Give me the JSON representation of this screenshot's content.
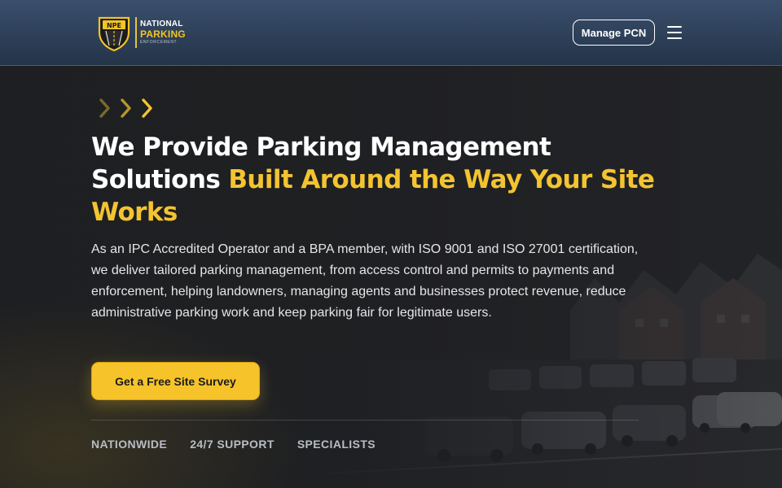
{
  "header": {
    "logo": {
      "badge_text": "NPE",
      "line1": "NATIONAL",
      "line2": "PARKING",
      "line3": "ENFORCEMENT"
    },
    "manage_pcn_label": "Manage PCN",
    "menu_icon": "hamburger-menu-icon"
  },
  "hero": {
    "decoration_icon": "triple-chevron-right-icon",
    "headline_part1": "We Provide Parking Management Solutions ",
    "headline_accent": "Built Around the Way Your Site Works",
    "intro": "As an IPC Accredited Operator and a BPA member, with ISO 9001 and ISO 27001 certification, we deliver tailored parking management, from access control and permits to payments and enforcement, helping landowners, managing agents and businesses protect revenue, reduce administrative parking work and keep parking fair for legitimate users.",
    "cta_label": "Get a Free Site Survey",
    "features": [
      "NATIONWIDE",
      "24/7 SUPPORT",
      "SPECIALISTS"
    ]
  },
  "colors": {
    "accent": "#f3c431",
    "header_top": "#3a4f6c",
    "header_bottom": "#243449",
    "hero_bg": "#1e1f22",
    "cta_bg": "#f6c42a",
    "feature_text": "#b8bcc3"
  }
}
